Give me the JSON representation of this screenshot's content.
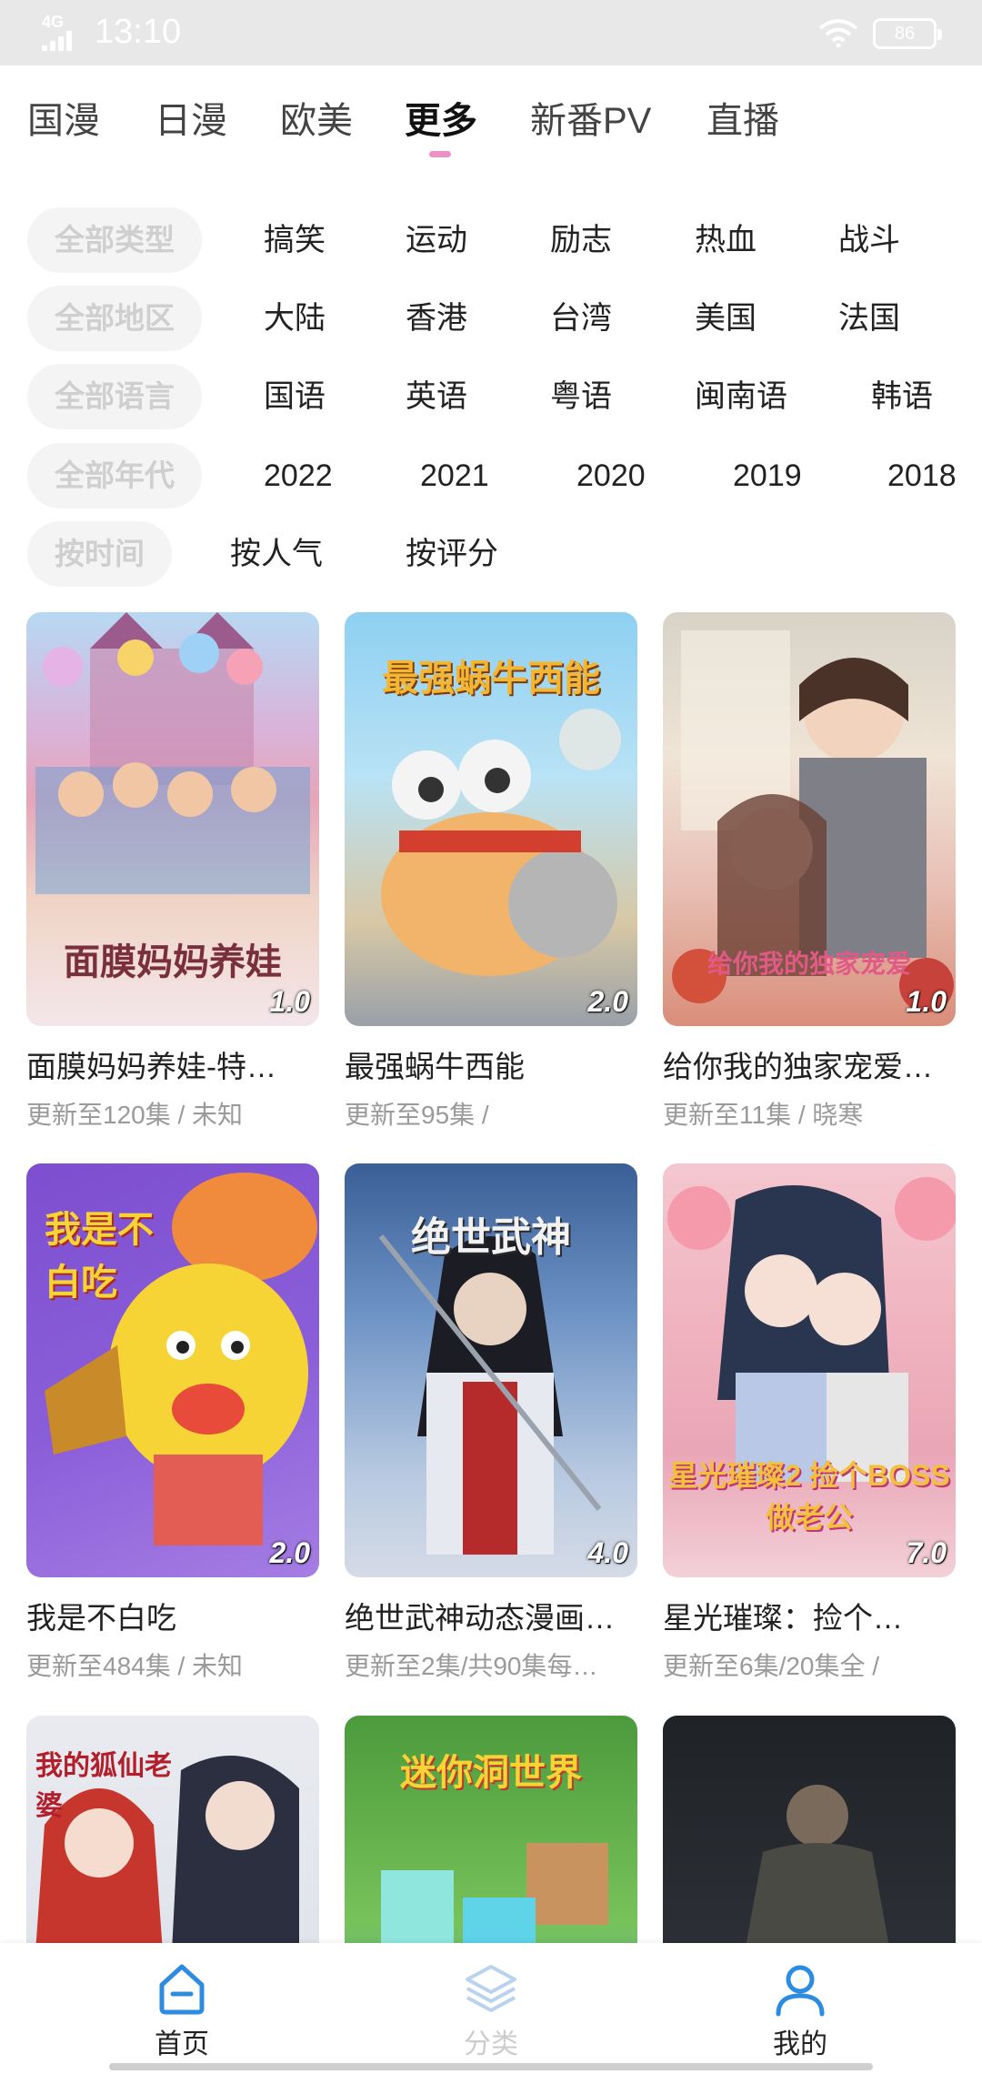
{
  "status": {
    "network": "4G",
    "time": "13:10",
    "battery": "86"
  },
  "tabs": [
    "国漫",
    "日漫",
    "欧美",
    "更多",
    "新番PV",
    "直播"
  ],
  "filters": [
    {
      "label": "全部类型",
      "options": [
        "搞笑",
        "运动",
        "励志",
        "热血",
        "战斗"
      ]
    },
    {
      "label": "全部地区",
      "options": [
        "大陆",
        "香港",
        "台湾",
        "美国",
        "法国"
      ]
    },
    {
      "label": "全部语言",
      "options": [
        "国语",
        "英语",
        "粤语",
        "闽南语",
        "韩语"
      ]
    },
    {
      "label": "全部年代",
      "options": [
        "2022",
        "2021",
        "2020",
        "2019",
        "2018"
      ]
    },
    {
      "label": "按时间",
      "options": [
        "按人气",
        "按评分"
      ]
    }
  ],
  "cards": [
    {
      "title": "面膜妈妈养娃-特…",
      "subtitle": "更新至120集 / 未知",
      "score": "1.0",
      "art_text": "面膜妈妈养娃"
    },
    {
      "title": "最强蜗牛西能",
      "subtitle": "更新至95集 /",
      "score": "2.0",
      "art_text": "最强蜗牛西能"
    },
    {
      "title": "给你我的独家宠爱…",
      "subtitle": "更新至11集 / 晓寒",
      "score": "1.0",
      "art_text": "给你我的独家宠爱"
    },
    {
      "title": "我是不白吃",
      "subtitle": "更新至484集 / 未知",
      "score": "2.0",
      "art_text": "我是不白吃"
    },
    {
      "title": "绝世武神动态漫画…",
      "subtitle": "更新至2集/共90集每…",
      "score": "4.0",
      "art_text": "绝世武神"
    },
    {
      "title": "星光璀璨：捡个…",
      "subtitle": "更新至6集/20集全 /",
      "score": "7.0",
      "art_text": "星光璀璨2 捡个BOSS做老公"
    },
    {
      "title": "",
      "subtitle": "",
      "score": "",
      "art_text": "我的狐仙老婆"
    },
    {
      "title": "",
      "subtitle": "",
      "score": "",
      "art_text": "迷你洞世界"
    },
    {
      "title": "",
      "subtitle": "",
      "score": "",
      "art_text": ""
    }
  ],
  "nav": [
    "首页",
    "分类",
    "我的"
  ]
}
